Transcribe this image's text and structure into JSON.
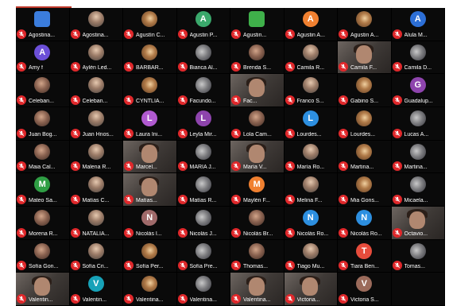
{
  "meeting": {
    "colors": {
      "background": "#000000",
      "mute_badge": "#e0282b",
      "name_text": "#ffffff"
    },
    "participants": [
      {
        "name": "Agostina...",
        "avatar": "logo",
        "color": "#3b7ddd"
      },
      {
        "name": "Agostina...",
        "avatar": "photo"
      },
      {
        "name": "Agustín C...",
        "avatar": "photo"
      },
      {
        "name": "Agustin P...",
        "avatar": "A",
        "color": "#3aa86b"
      },
      {
        "name": "Agustin...",
        "avatar": "logo",
        "color": "#3fb04a"
      },
      {
        "name": "Agustin A...",
        "avatar": "A",
        "color": "#f08030"
      },
      {
        "name": "Agustin A...",
        "avatar": "photo"
      },
      {
        "name": "Alula M...",
        "avatar": "A",
        "color": "#2d6fd6"
      },
      {
        "name": "Amy f",
        "avatar": "A",
        "color": "#6c4fd8"
      },
      {
        "name": "Aylén Led...",
        "avatar": "photo"
      },
      {
        "name": "BARBAR...",
        "avatar": "photo"
      },
      {
        "name": "Bianca Al...",
        "avatar": "photo"
      },
      {
        "name": "Brenda S...",
        "avatar": "photo"
      },
      {
        "name": "Camila R...",
        "avatar": "photo"
      },
      {
        "name": "Camila F...",
        "avatar": "video"
      },
      {
        "name": "Camila D...",
        "avatar": "photo"
      },
      {
        "name": "Celeban...",
        "avatar": "photo"
      },
      {
        "name": "Celeban...",
        "avatar": "photo"
      },
      {
        "name": "CYNTLIA...",
        "avatar": "photo"
      },
      {
        "name": "Facundo...",
        "avatar": "photo"
      },
      {
        "name": "Fac...",
        "avatar": "video"
      },
      {
        "name": "Franco S...",
        "avatar": "photo"
      },
      {
        "name": "Gabino S...",
        "avatar": "photo"
      },
      {
        "name": "Guadalup...",
        "avatar": "G",
        "color": "#8e44ad"
      },
      {
        "name": "Juan Bog...",
        "avatar": "photo"
      },
      {
        "name": "Juan Hnos...",
        "avatar": "photo"
      },
      {
        "name": "Laura Ini...",
        "avatar": "L",
        "color": "#b05ad0"
      },
      {
        "name": "Leyla Mir...",
        "avatar": "L",
        "color": "#8e44ad"
      },
      {
        "name": "Lola Cam...",
        "avatar": "photo"
      },
      {
        "name": "Lourdes...",
        "avatar": "L",
        "color": "#2d8fe0"
      },
      {
        "name": "Lourdes...",
        "avatar": "photo"
      },
      {
        "name": "Lucas A...",
        "avatar": "photo"
      },
      {
        "name": "Maia Cal...",
        "avatar": "photo"
      },
      {
        "name": "Malena R...",
        "avatar": "photo"
      },
      {
        "name": "Marcel...",
        "avatar": "video"
      },
      {
        "name": "MARIA J...",
        "avatar": "photo"
      },
      {
        "name": "María V...",
        "avatar": "video"
      },
      {
        "name": "María Ro...",
        "avatar": "photo"
      },
      {
        "name": "Martina...",
        "avatar": "photo"
      },
      {
        "name": "Martina...",
        "avatar": "photo"
      },
      {
        "name": "Mateo Sa...",
        "avatar": "M",
        "color": "#2f9e44"
      },
      {
        "name": "Matías C...",
        "avatar": "photo"
      },
      {
        "name": "Matías...",
        "avatar": "video"
      },
      {
        "name": "Matías R...",
        "avatar": "photo"
      },
      {
        "name": "Maylén F...",
        "avatar": "M",
        "color": "#f08030"
      },
      {
        "name": "Melina F...",
        "avatar": "photo"
      },
      {
        "name": "Mia Gons...",
        "avatar": "photo"
      },
      {
        "name": "Micaela...",
        "avatar": "photo"
      },
      {
        "name": "Morena R...",
        "avatar": "photo"
      },
      {
        "name": "NATALIA...",
        "avatar": "photo"
      },
      {
        "name": "Nicolás I...",
        "avatar": "N",
        "color": "#a06a6a"
      },
      {
        "name": "Nicolás J...",
        "avatar": "photo"
      },
      {
        "name": "Nicolás Br...",
        "avatar": "photo"
      },
      {
        "name": "Nicolás Ro...",
        "avatar": "N",
        "color": "#2d8fe0"
      },
      {
        "name": "Nicolás Ro...",
        "avatar": "N",
        "color": "#2d8fe0"
      },
      {
        "name": "Octavio...",
        "avatar": "video"
      },
      {
        "name": "Sofía Gon...",
        "avatar": "photo"
      },
      {
        "name": "Sofía Cri...",
        "avatar": "photo"
      },
      {
        "name": "Sofía Per...",
        "avatar": "photo"
      },
      {
        "name": "Sofía Pre...",
        "avatar": "photo"
      },
      {
        "name": "Thomas...",
        "avatar": "photo"
      },
      {
        "name": "Tiago Mu...",
        "avatar": "photo"
      },
      {
        "name": "Tiara Ben...",
        "avatar": "T",
        "color": "#e74c3c"
      },
      {
        "name": "Tomas...",
        "avatar": "photo"
      },
      {
        "name": "Valentin...",
        "avatar": "video"
      },
      {
        "name": "Valentin...",
        "avatar": "V",
        "color": "#17a2b8"
      },
      {
        "name": "Valentina...",
        "avatar": "photo"
      },
      {
        "name": "Valentina...",
        "avatar": "photo"
      },
      {
        "name": "Valentina...",
        "avatar": "video"
      },
      {
        "name": "Victoria...",
        "avatar": "video"
      },
      {
        "name": "Victoria S...",
        "avatar": "V",
        "color": "#9b6b5b"
      },
      {
        "name": "",
        "avatar": "empty"
      }
    ]
  }
}
